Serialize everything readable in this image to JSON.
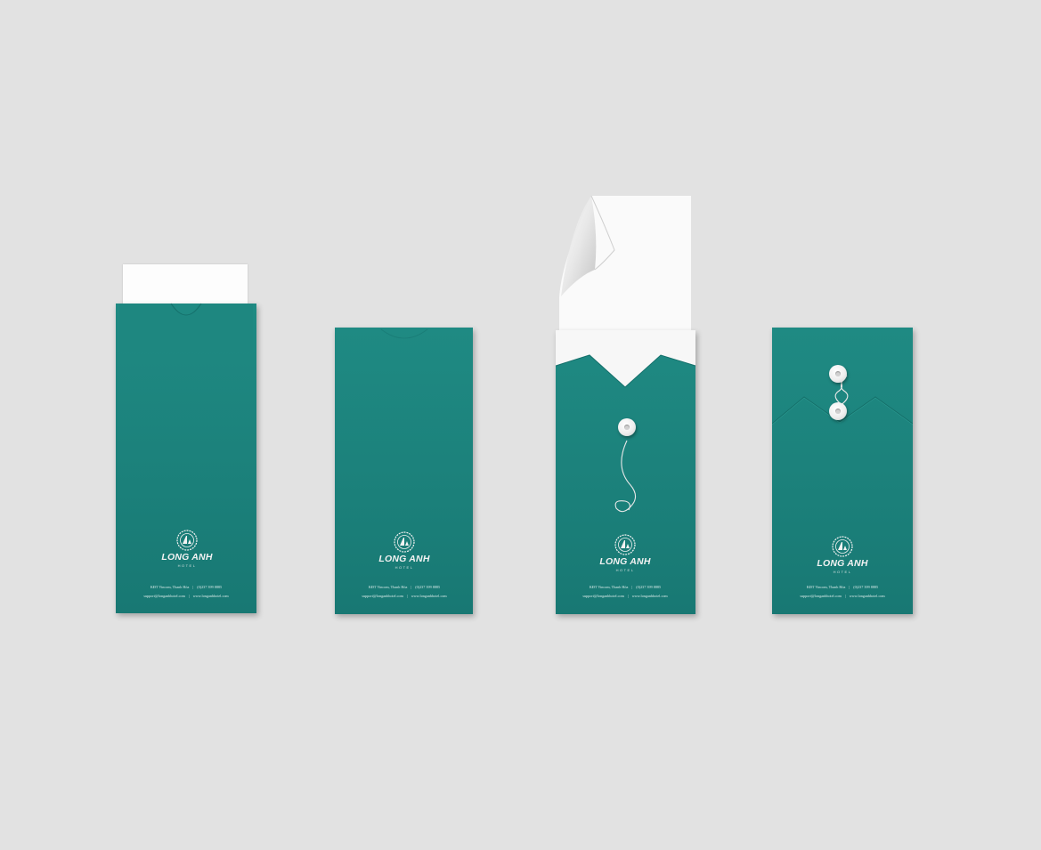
{
  "scene": {
    "background_color": "#e2e2e2",
    "envelope_color": "#1d857e"
  },
  "envelopes": [
    {
      "brand": "LONG ANH",
      "subbrand": "HOTEL",
      "contact_line1_left": "KĐT Vincom, Thanh Hóa",
      "contact_line1_right": "(0)237 399 8885",
      "contact_line2_left": "support@longanhhotel.com",
      "contact_line2_right": "www.longanhhotel.com"
    },
    {
      "brand": "LONG ANH",
      "subbrand": "HOTEL",
      "contact_line1_left": "KĐT Vincom, Thanh Hóa",
      "contact_line1_right": "(0)237 399 8885",
      "contact_line2_left": "support@longanhhotel.com",
      "contact_line2_right": "www.longanhhotel.com"
    },
    {
      "brand": "LONG ANH",
      "subbrand": "HOTEL",
      "contact_line1_left": "KĐT Vincom, Thanh Hóa",
      "contact_line1_right": "(0)237 399 8885",
      "contact_line2_left": "support@longanhhotel.com",
      "contact_line2_right": "www.longanhhotel.com"
    },
    {
      "brand": "LONG ANH",
      "subbrand": "HOTEL",
      "contact_line1_left": "KĐT Vincom, Thanh Hóa",
      "contact_line1_right": "(0)237 399 8885",
      "contact_line2_left": "support@longanhhotel.com",
      "contact_line2_right": "www.longanhhotel.com"
    }
  ]
}
